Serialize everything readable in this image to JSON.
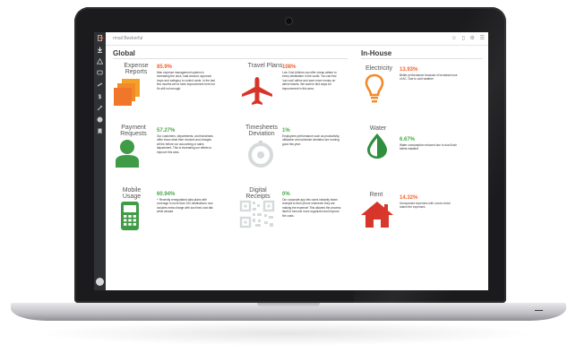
{
  "app": {
    "brand": "rmail Beekerful",
    "logo": "»»"
  },
  "colors": {
    "orange": "#f0642d",
    "green": "#4aa84a",
    "red": "#d8352a",
    "gray": "#cfd3d4"
  },
  "sections": {
    "global_title": "Global",
    "inhouse_title": "In-House"
  },
  "metrics": {
    "expense": {
      "label": "Expense\nReports",
      "value": "85.9%",
      "desc": "Man expense management system is increasing the docs, load amount, approval loops and category to control costs. In the last few months we've seen improvement here but it's still not enough."
    },
    "travel": {
      "label": "Travel Plans",
      "value": "108%",
      "desc": "Low Cost Airlines can offer cheap airfare to every destination in the world. You can find 'can cost' airline and save more money on airline tickets. We want to find ways for improvement in this area."
    },
    "electricity": {
      "label": "Electricity",
      "value": "13.93%",
      "desc": "Better performance because of increased use of AC. Due to cold weather"
    },
    "payment": {
      "label": "Payment\nRequests",
      "value": "57.27%",
      "desc": "Our customers, departments, and franchises often know what their invoices and charges will be before our accounting or sales department. This is increasing our efforts to improve this area."
    },
    "timesheets": {
      "label": "Timesheets\nDeviation",
      "value": "1%",
      "desc": "Employees performance such as productivity, utilization and schedule deviation are running good this year."
    },
    "water": {
      "label": "Water",
      "value": "6.67%",
      "desc": "Water consumption reduced due to dual flush toilets installed"
    },
    "mobile": {
      "label": "Mobile\nUsage",
      "value": "60.94%",
      "desc": "+ Recently renegotiated data plans with coverage in more than 100 destinations now includes extra charge with low fixed cost talk while abroad."
    },
    "receipts": {
      "label": "Digital\nReceipts",
      "value": "0%",
      "desc": "Our corporate app lets users instantly beam receipts to their phone whenever they are making the expense! This allowed the process itself to become more organized and improve the costs."
    },
    "rent": {
      "label": "Rent",
      "value": "14.32%",
      "desc": "Unexpected expenses with condo rental raised the expenses"
    }
  },
  "sidebar": {
    "icons": [
      "document-icon",
      "download-icon",
      "warning-icon",
      "chat-icon",
      "link-icon",
      "dollar-icon",
      "tools-icon",
      "info-icon",
      "bookmark-icon"
    ]
  }
}
